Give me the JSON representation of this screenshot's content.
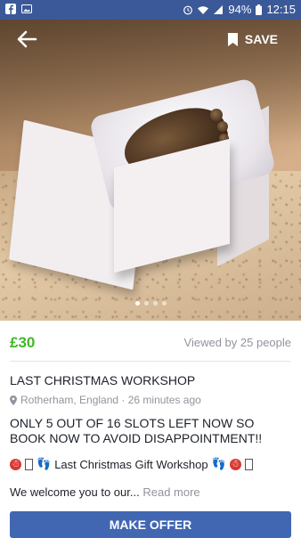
{
  "status_bar": {
    "battery": "94%",
    "time": "12:15",
    "icons": [
      "facebook-icon",
      "image-icon",
      "alarm-icon",
      "wifi-icon",
      "signal-icon",
      "battery-icon"
    ]
  },
  "hero": {
    "save_label": "SAVE",
    "carousel_pages": 4,
    "active_page": 1
  },
  "listing": {
    "price": "£30",
    "views": "Viewed by 25 people",
    "title": "LAST CHRISTMAS WORKSHOP",
    "location": "Rotherham, England · 26 minutes ago",
    "description_line": "ONLY 5 OUT OF 16 SLOTS LEFT NOW SO BOOK NOW TO AVOID DISAPPOINTMENT!!",
    "gift_line": "Last Christmas Gift Workshop",
    "intro": "We welcome you to our...",
    "read_more": "Read more"
  },
  "actions": {
    "make_offer": "MAKE OFFER"
  },
  "colors": {
    "status_bar": "#3b5998",
    "price": "#42b72a",
    "button": "#4267b2"
  }
}
